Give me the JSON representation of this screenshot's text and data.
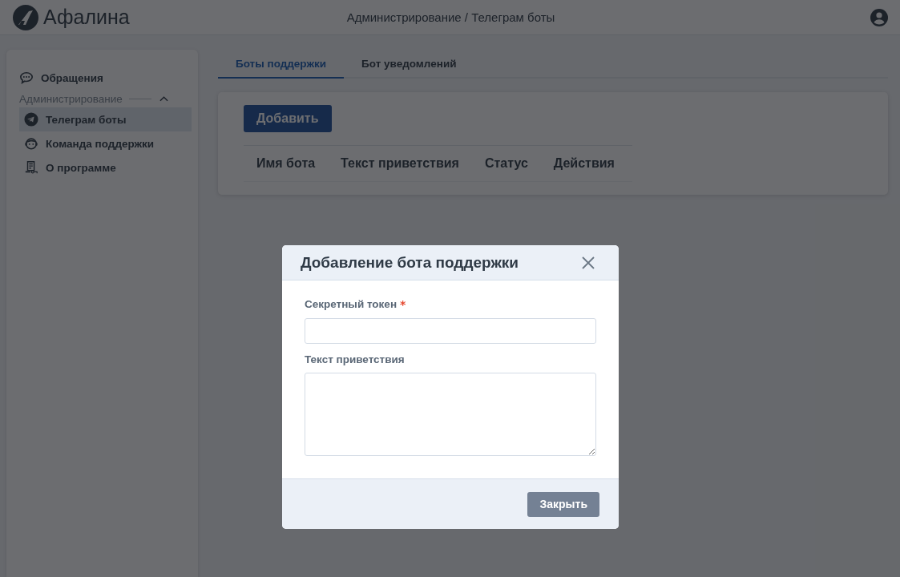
{
  "header": {
    "logo_text": "Афалина",
    "breadcrumb": "Администрирование / Телеграм боты"
  },
  "sidebar": {
    "items": [
      {
        "kind": "link",
        "label": "Обращения",
        "selected": false
      },
      {
        "kind": "section",
        "label": "Администрирование",
        "expanded": true,
        "children": [
          {
            "label": "Телеграм боты",
            "selected": true
          },
          {
            "label": "Команда поддержки",
            "selected": false
          },
          {
            "label": "О программе",
            "selected": false
          }
        ]
      }
    ]
  },
  "tabs": [
    {
      "label": "Боты поддержки",
      "selected": true
    },
    {
      "label": "Бот уведомлений",
      "selected": false
    }
  ],
  "add_button": "Добавить",
  "table": {
    "columns": [
      "Имя бота",
      "Текст приветствия",
      "Статус",
      "Действия"
    ]
  },
  "modal": {
    "title": "Добавление бота поддержки",
    "fields": [
      {
        "kind": "input",
        "label": "Секретный токен",
        "required_mark": "*"
      },
      {
        "kind": "textarea",
        "label": "Текст приветствия"
      }
    ],
    "close_button": "Закрыть"
  }
}
